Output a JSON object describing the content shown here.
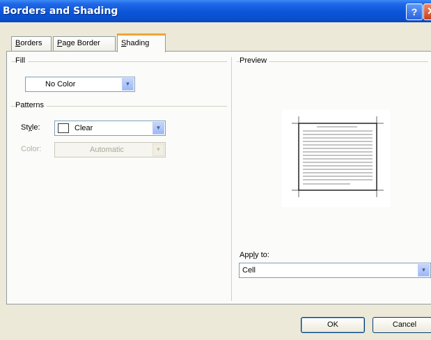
{
  "window": {
    "title": "Borders and Shading",
    "help_glyph": "?",
    "close_glyph": "✕"
  },
  "tabs": [
    {
      "label": "Borders",
      "mnemonic": "B",
      "rest": "orders",
      "active": false
    },
    {
      "label": "Page Border",
      "mnemonic": "P",
      "rest": "age Border",
      "active": false
    },
    {
      "label": "Shading",
      "mnemonic": "S",
      "rest": "hading",
      "active": true
    }
  ],
  "fill": {
    "group_label": "Fill",
    "color_value": "No Color"
  },
  "patterns": {
    "group_label": "Patterns",
    "style_label_pre": "St",
    "style_label_mnemonic": "y",
    "style_label_post": "le:",
    "style_value": "Clear",
    "color_label": "Color:",
    "color_value": "Automatic"
  },
  "preview": {
    "group_label": "Preview"
  },
  "apply_to": {
    "label_pre": "App",
    "label_mnemonic": "l",
    "label_post": "y to:",
    "value": "Cell"
  },
  "buttons": {
    "ok": "OK",
    "cancel": "Cancel"
  },
  "colors": {
    "accent_tab": "#f1a535",
    "titlebar": "#0b55d9",
    "dialog_bg": "#ece9d8"
  }
}
